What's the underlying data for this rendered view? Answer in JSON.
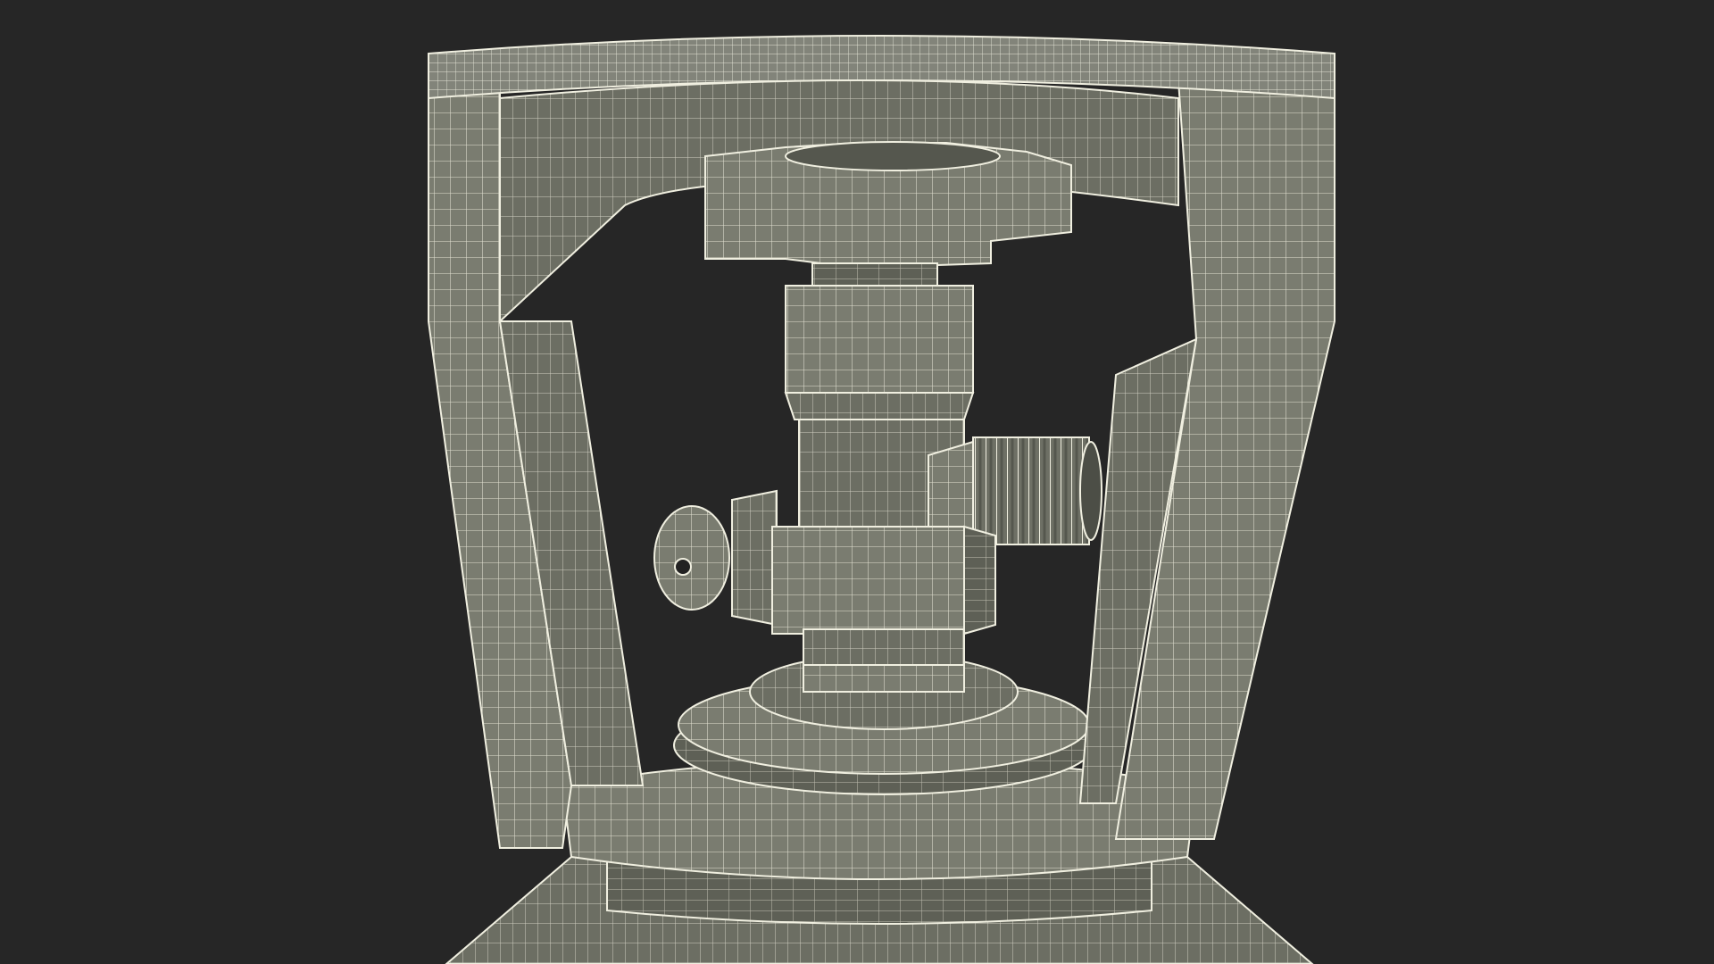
{
  "scene": {
    "background_color": "#262626",
    "model_fill": "#787a6e",
    "model_fill_dark": "#5f6157",
    "model_fill_light": "#8a8c80",
    "wire_color": "#e8e8d8",
    "subject": "gas-cylinder-valve-wireframe"
  }
}
